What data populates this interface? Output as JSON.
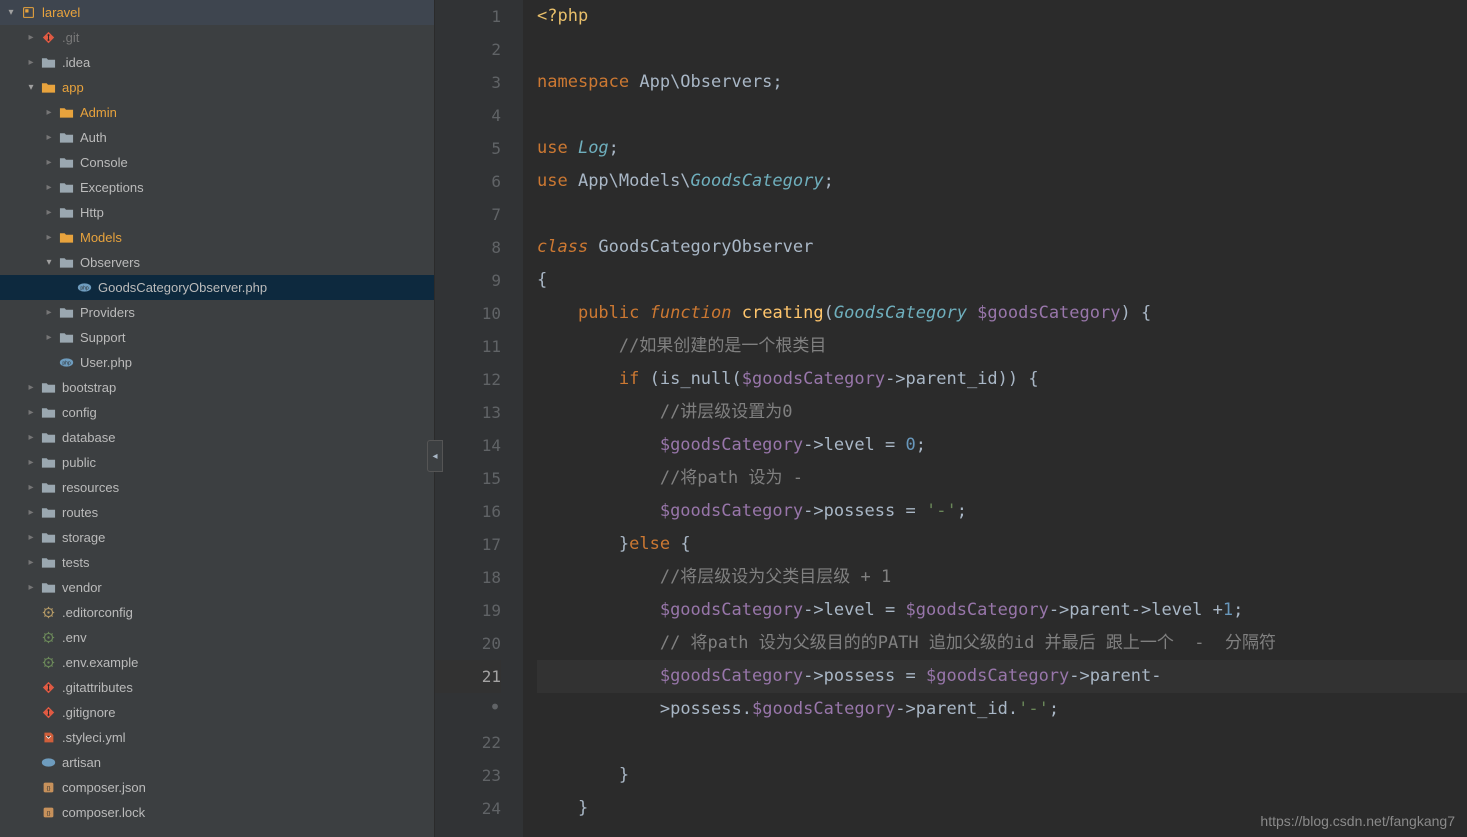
{
  "tree": {
    "root": {
      "label": "laravel"
    },
    "items": [
      {
        "label": ".git",
        "type": "git",
        "depth": 1,
        "dim": true
      },
      {
        "label": ".idea",
        "type": "folder",
        "depth": 1
      },
      {
        "label": "app",
        "type": "folder-o",
        "depth": 1,
        "expanded": true
      },
      {
        "label": "Admin",
        "type": "folder-o",
        "depth": 2
      },
      {
        "label": "Auth",
        "type": "folder",
        "depth": 2
      },
      {
        "label": "Console",
        "type": "folder",
        "depth": 2
      },
      {
        "label": "Exceptions",
        "type": "folder",
        "depth": 2
      },
      {
        "label": "Http",
        "type": "folder",
        "depth": 2
      },
      {
        "label": "Models",
        "type": "folder-o",
        "depth": 2
      },
      {
        "label": "Observers",
        "type": "folder",
        "depth": 2,
        "expanded": true
      },
      {
        "label": "GoodsCategoryObserver.php",
        "type": "php",
        "depth": 3,
        "selected": true
      },
      {
        "label": "Providers",
        "type": "folder",
        "depth": 2
      },
      {
        "label": "Support",
        "type": "folder",
        "depth": 2
      },
      {
        "label": "User.php",
        "type": "php",
        "depth": 2
      },
      {
        "label": "bootstrap",
        "type": "folder",
        "depth": 1
      },
      {
        "label": "config",
        "type": "folder",
        "depth": 1
      },
      {
        "label": "database",
        "type": "folder",
        "depth": 1
      },
      {
        "label": "public",
        "type": "folder",
        "depth": 1
      },
      {
        "label": "resources",
        "type": "folder",
        "depth": 1
      },
      {
        "label": "routes",
        "type": "folder",
        "depth": 1
      },
      {
        "label": "storage",
        "type": "folder",
        "depth": 1
      },
      {
        "label": "tests",
        "type": "folder",
        "depth": 1
      },
      {
        "label": "vendor",
        "type": "folder",
        "depth": 1
      },
      {
        "label": ".editorconfig",
        "type": "gear-y",
        "depth": 1
      },
      {
        "label": ".env",
        "type": "gear-g",
        "depth": 1
      },
      {
        "label": ".env.example",
        "type": "gear-g",
        "depth": 1
      },
      {
        "label": ".gitattributes",
        "type": "git",
        "depth": 1
      },
      {
        "label": ".gitignore",
        "type": "git",
        "depth": 1
      },
      {
        "label": ".styleci.yml",
        "type": "yml",
        "depth": 1
      },
      {
        "label": "artisan",
        "type": "elephant",
        "depth": 1
      },
      {
        "label": "composer.json",
        "type": "json",
        "depth": 1
      },
      {
        "label": "composer.lock",
        "type": "json",
        "depth": 1
      }
    ]
  },
  "editor": {
    "line_numbers": [
      "1",
      "2",
      "3",
      "4",
      "5",
      "6",
      "7",
      "8",
      "9",
      "10",
      "11",
      "12",
      "13",
      "14",
      "15",
      "16",
      "17",
      "18",
      "19",
      "20",
      "21",
      "·",
      "22",
      "23",
      "24"
    ],
    "current_line_index": 20,
    "code": {
      "l1_open": "<?php",
      "l3_ns_kw": "namespace",
      "l3_ns": " App\\Observers;",
      "l5_use_kw": "use",
      "l5_use": " Log",
      "l5_sc": ";",
      "l6_use_kw": "use",
      "l6_ns": " App\\Models\\",
      "l6_cls": "GoodsCategory",
      "l6_sc": ";",
      "l8_class_kw": "class",
      "l8_cls": " GoodsCategoryObserver",
      "l9_brace": "{",
      "l10_pub": "public",
      "l10_fn_kw": " function",
      "l10_fn": " creating",
      "l10_open": "(",
      "l10_type": "GoodsCategory",
      "l10_var": " $goodsCategory",
      "l10_close": ") {",
      "l11_cmt": "//如果创建的是一个根类目",
      "l12_if": "if",
      "l12_open": " (",
      "l12_fn": "is_null",
      "l12_p1": "(",
      "l12_var": "$goodsCategory",
      "l12_arrow": "->",
      "l12_prop": "parent_id",
      "l12_p2": ")) {",
      "l13_cmt": "//讲层级设置为0",
      "l14_var": "$goodsCategory",
      "l14_arrow": "->",
      "l14_prop": "level",
      "l14_eq": " = ",
      "l14_num": "0",
      "l14_sc": ";",
      "l15_cmt": "//将path 设为 -",
      "l16_var": "$goodsCategory",
      "l16_arrow": "->",
      "l16_prop": "possess",
      "l16_eq": " = ",
      "l16_str": "'-'",
      "l16_sc": ";",
      "l17_close": "}",
      "l17_else": "else",
      "l17_open": " {",
      "l18_cmt": "//将层级设为父类目层级 + 1",
      "l19_var1": "$goodsCategory",
      "l19_a1": "->",
      "l19_p1": "level",
      "l19_eq": " = ",
      "l19_var2": "$goodsCategory",
      "l19_a2": "->",
      "l19_p2": "parent",
      "l19_a3": "->",
      "l19_p3": "level ",
      "l19_plus": "+",
      "l19_num": "1",
      "l19_sc": ";",
      "l20_cmt": "// 将path 设为父级目的的PATH 追加父级的id 并最后 跟上一个  -  分隔符",
      "l21_var1": "$goodsCategory",
      "l21_a1": "->",
      "l21_p1": "possess",
      "l21_eq": " = ",
      "l21_var2": "$goodsCategory",
      "l21_a2": "->",
      "l21_p2": "parent",
      "l21_a3": "-",
      "l21b_gt": ">",
      "l21b_p1": "possess",
      "l21b_dot": ".",
      "l21b_var": "$goodsCategory",
      "l21b_a1": "->",
      "l21b_p2": "parent_id",
      "l21b_dot2": ".",
      "l21b_str": "'-'",
      "l21b_sc": ";",
      "l23_close": "}",
      "l24_close": "}"
    }
  },
  "watermark": "https://blog.csdn.net/fangkang7"
}
